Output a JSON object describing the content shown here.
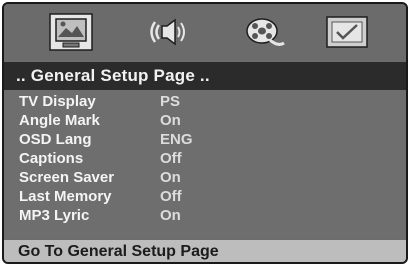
{
  "menu_icons": [
    {
      "name": "general-setup-icon",
      "selected": true
    },
    {
      "name": "audio-setup-icon",
      "selected": false
    },
    {
      "name": "video-setup-icon",
      "selected": false
    },
    {
      "name": "preference-setup-icon",
      "selected": false
    }
  ],
  "page": {
    "title": ".. General Setup Page .."
  },
  "settings": [
    {
      "label": "TV Display",
      "value": "PS"
    },
    {
      "label": "Angle Mark",
      "value": "On"
    },
    {
      "label": "OSD Lang",
      "value": "ENG"
    },
    {
      "label": "Captions",
      "value": "Off"
    },
    {
      "label": "Screen Saver",
      "value": "On"
    },
    {
      "label": "Last Memory",
      "value": "Off"
    },
    {
      "label": "MP3 Lyric",
      "value": "On"
    }
  ],
  "status": {
    "text": "Go To General Setup Page"
  },
  "colors": {
    "panel_bg": "#6d6d6d",
    "title_bar_bg": "#2b2b2b",
    "status_bar_bg": "#bdbdbd",
    "text_light": "#f4f4f4"
  }
}
